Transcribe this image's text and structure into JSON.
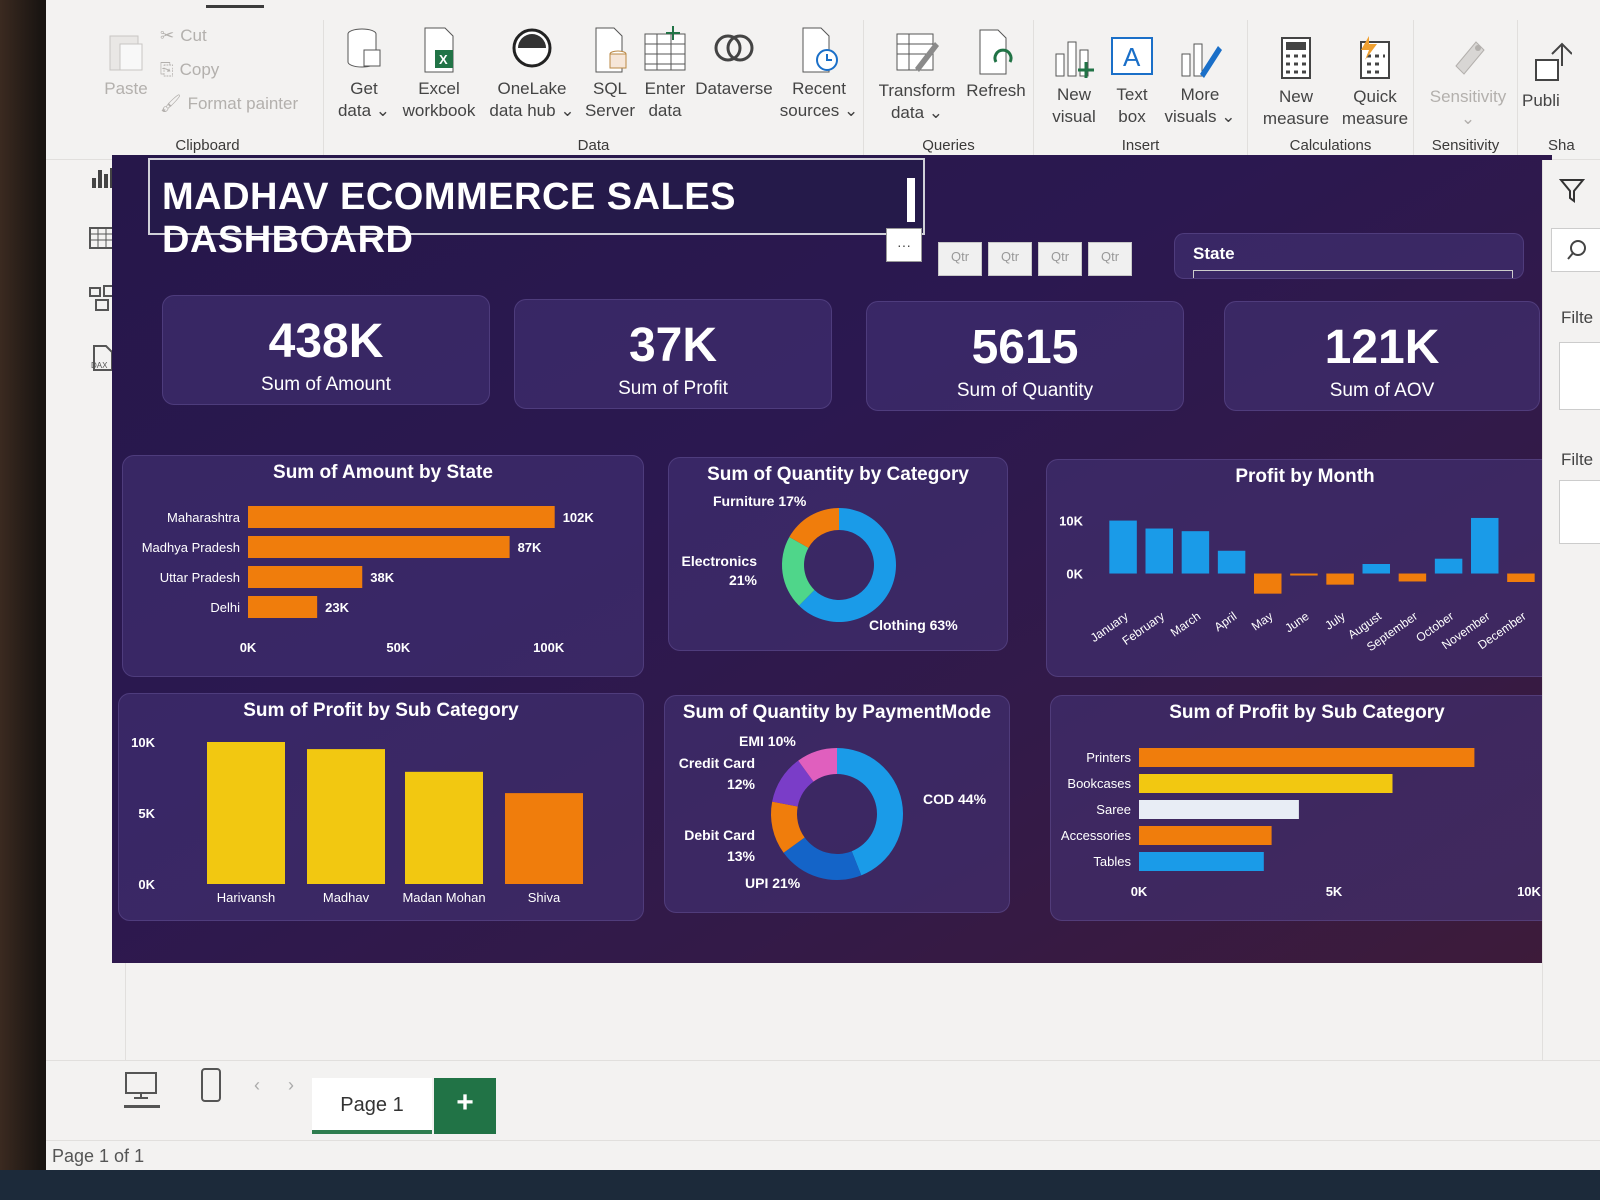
{
  "ribbon": {
    "clipboard": {
      "label": "Clipboard",
      "paste": "Paste",
      "cut": "Cut",
      "copy": "Copy",
      "format_painter": "Format painter"
    },
    "data": {
      "label": "Data",
      "get_data": [
        "Get",
        "data ⌄"
      ],
      "excel": [
        "Excel",
        "workbook"
      ],
      "onelake": [
        "OneLake",
        "data hub ⌄"
      ],
      "sql": [
        "SQL",
        "Server"
      ],
      "enter": [
        "Enter",
        "data"
      ],
      "dataverse": "Dataverse",
      "recent": [
        "Recent",
        "sources ⌄"
      ]
    },
    "queries": {
      "label": "Queries",
      "transform": [
        "Transform",
        "data ⌄"
      ],
      "refresh": "Refresh"
    },
    "insert": {
      "label": "Insert",
      "new_visual": [
        "New",
        "visual"
      ],
      "text_box": [
        "Text",
        "box"
      ],
      "more_visuals": [
        "More",
        "visuals ⌄"
      ]
    },
    "calculations": {
      "label": "Calculations",
      "new_measure": [
        "New",
        "measure"
      ],
      "quick_measure": [
        "Quick",
        "measure"
      ]
    },
    "sensitivity": {
      "label": "Sensitivity",
      "btn": [
        "Sensitivity",
        "⌄"
      ]
    },
    "share": {
      "label": "Sha",
      "publish": "Publi"
    }
  },
  "dashboard": {
    "title": "MADHAV ECOMMERCE SALES DASHBOARD",
    "slicer_buttons": [
      "Qtr",
      "Qtr",
      "Qtr",
      "Qtr"
    ],
    "state_slicer_label": "State",
    "kpis": [
      {
        "value": "438K",
        "label": "Sum of Amount"
      },
      {
        "value": "37K",
        "label": "Sum of Profit"
      },
      {
        "value": "5615",
        "label": "Sum of Quantity"
      },
      {
        "value": "121K",
        "label": "Sum of AOV"
      }
    ]
  },
  "right_pane": {
    "filters_a": "Filte",
    "filters_b": "Filte"
  },
  "footer": {
    "page_tab": "Page 1",
    "add_tab": "+",
    "status": "Page 1 of 1"
  },
  "colors": {
    "orange": "#f07d0c",
    "yellow": "#f2c811",
    "blue": "#1a9be8",
    "dark_blue": "#1464c8",
    "green": "#4fd68a",
    "pink": "#e05fbe",
    "purple": "#7a3dc8",
    "white_bar": "#e8edf5"
  },
  "chart_data": [
    {
      "type": "bar",
      "orientation": "horizontal",
      "title": "Sum of Amount by State",
      "categories": [
        "Maharashtra",
        "Madhya Pradesh",
        "Uttar Pradesh",
        "Delhi"
      ],
      "values": [
        102000,
        87000,
        38000,
        23000
      ],
      "data_labels": [
        "102K",
        "87K",
        "38K",
        "23K"
      ],
      "xlim": [
        0,
        110000
      ],
      "xticks": [
        "0K",
        "50K",
        "100K"
      ]
    },
    {
      "type": "pie",
      "variant": "donut",
      "title": "Sum of Quantity by Category",
      "labels": [
        "Clothing",
        "Electronics",
        "Furniture"
      ],
      "values": [
        63,
        21,
        17
      ],
      "data_labels": [
        "Clothing 63%",
        "Electronics",
        "21%",
        "Furniture 17%"
      ]
    },
    {
      "type": "bar",
      "title": "Profit by Month",
      "categories": [
        "January",
        "February",
        "March",
        "April",
        "May",
        "June",
        "July",
        "August",
        "September",
        "October",
        "November",
        "December"
      ],
      "values": [
        10000,
        8500,
        8000,
        4300,
        -3800,
        -300,
        -2100,
        1800,
        -1500,
        2800,
        10500,
        -1600
      ],
      "yticks": [
        "10K",
        "0K"
      ],
      "ylim": [
        -5000,
        12000
      ]
    },
    {
      "type": "bar",
      "title": "Sum of Profit by Sub Category",
      "categories": [
        "Harivansh",
        "Madhav",
        "Madan Mohan",
        "Shiva"
      ],
      "values": [
        10000,
        9500,
        7900,
        6400
      ],
      "yticks": [
        "10K",
        "5K",
        "0K"
      ],
      "ylim": [
        0,
        10000
      ]
    },
    {
      "type": "pie",
      "variant": "donut",
      "title": "Sum of Quantity by PaymentMode",
      "labels": [
        "COD",
        "UPI",
        "Debit Card",
        "Credit Card",
        "EMI"
      ],
      "values": [
        44,
        21,
        13,
        12,
        10
      ],
      "data_labels": [
        "COD 44%",
        "UPI 21%",
        "Debit Card",
        "13%",
        "Credit Card",
        "12%",
        "EMI 10%"
      ]
    },
    {
      "type": "bar",
      "orientation": "horizontal",
      "title": "Sum of Profit by Sub Category",
      "categories": [
        "Printers",
        "Bookcases",
        "Saree",
        "Accessories",
        "Tables"
      ],
      "values": [
        8600,
        6500,
        4100,
        3400,
        3200
      ],
      "xlim": [
        0,
        10000
      ],
      "xticks": [
        "0K",
        "5K",
        "10K"
      ]
    }
  ]
}
